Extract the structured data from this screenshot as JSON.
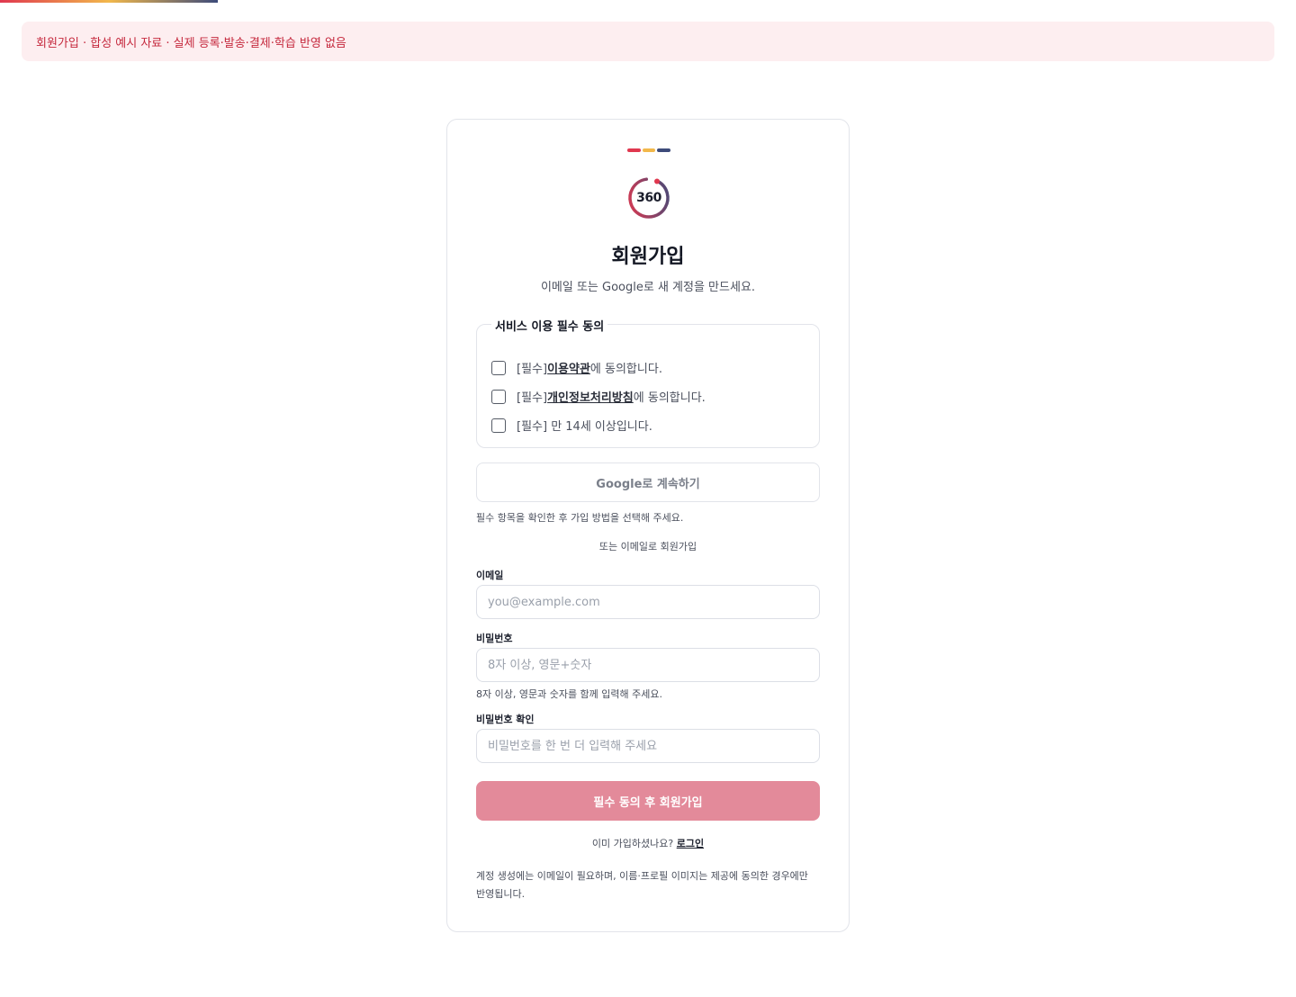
{
  "notice": {
    "text": "회원가입 · 합성 예시 자료 · 실제 등록·발송·결제·학습 반영 없음"
  },
  "brand": {
    "bar_colors": [
      "#e0384f",
      "#f2b84b",
      "#3d4b7a"
    ],
    "logo_text": "360",
    "progress_level": 0.17
  },
  "header": {
    "title": "회원가입",
    "subtitle": "이메일 또는 Google로 새 계정을 만드세요."
  },
  "consent": {
    "legend": "서비스 이용 필수 동의",
    "items": [
      {
        "prefix": "[필수] ",
        "link": "이용약관",
        "suffix": "에 동의합니다.",
        "checked": false
      },
      {
        "prefix": "[필수] ",
        "link": "개인정보처리방침",
        "suffix": "에 동의합니다.",
        "checked": false
      },
      {
        "prefix": "[필수] 만 14세 이상입니다.",
        "checked": false
      }
    ]
  },
  "google": {
    "button_label": "Google로 계속하기",
    "hint": "필수 항목을 확인한 후 가입 방법을 선택해 주세요."
  },
  "divider": "또는 이메일로 회원가입",
  "form": {
    "email": {
      "label": "이메일",
      "placeholder": "you@example.com",
      "value": ""
    },
    "password": {
      "label": "비밀번호",
      "placeholder": "8자 이상, 영문+숫자",
      "value": "",
      "hint": "8자 이상, 영문과 숫자를 함께 입력해 주세요."
    },
    "password_confirm": {
      "label": "비밀번호 확인",
      "placeholder": "비밀번호를 한 번 더 입력해 주세요",
      "value": ""
    }
  },
  "submit": {
    "label": "필수 동의 후 회원가입",
    "color": "#e38a9a"
  },
  "login": {
    "prompt": "이미 가입하셨나요? ",
    "link": "로그인"
  },
  "footnote": "계정 생성에는 이메일이 필요하며, 이름·프로필 이미지는 제공에 동의한 경우에만 반영됩니다."
}
